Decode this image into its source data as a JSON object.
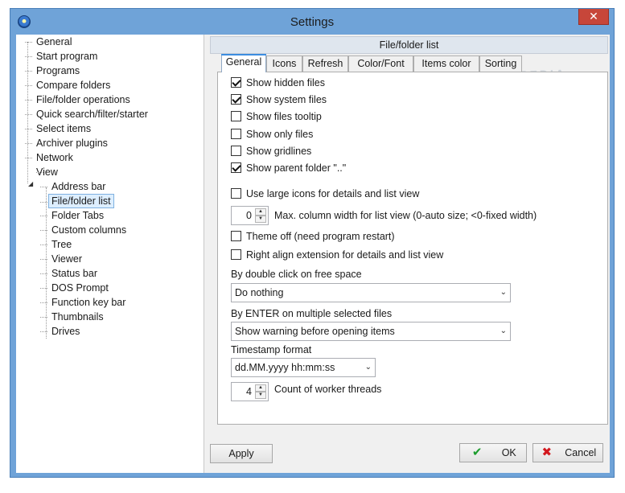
{
  "window": {
    "title": "Settings",
    "close_glyph": "✕"
  },
  "tree": {
    "items": [
      {
        "label": "General"
      },
      {
        "label": "Start program"
      },
      {
        "label": "Programs"
      },
      {
        "label": "Compare folders"
      },
      {
        "label": "File/folder operations"
      },
      {
        "label": "Quick search/filter/starter"
      },
      {
        "label": "Select items"
      },
      {
        "label": "Archiver plugins"
      },
      {
        "label": "Network"
      },
      {
        "label": "View",
        "expanded": true
      },
      {
        "label": "Address bar"
      },
      {
        "label": "File/folder list",
        "selected": true
      },
      {
        "label": "Folder Tabs"
      },
      {
        "label": "Custom columns"
      },
      {
        "label": "Tree"
      },
      {
        "label": "Viewer"
      },
      {
        "label": "Status bar"
      },
      {
        "label": "DOS Prompt"
      },
      {
        "label": "Function key bar"
      },
      {
        "label": "Thumbnails"
      },
      {
        "label": "Drives"
      }
    ]
  },
  "section_header": "File/folder list",
  "tabs": [
    {
      "label": "General",
      "active": true
    },
    {
      "label": "Icons"
    },
    {
      "label": "Refresh"
    },
    {
      "label": "Color/Font"
    },
    {
      "label": "Items color"
    },
    {
      "label": "Sorting"
    }
  ],
  "options": [
    {
      "label": "Show hidden files",
      "checked": true
    },
    {
      "label": "Show system files",
      "checked": true
    },
    {
      "label": "Show files tooltip",
      "checked": false
    },
    {
      "label": "Show only files",
      "checked": false
    },
    {
      "label": "Show gridlines",
      "checked": false
    },
    {
      "label": "Show parent folder \"..\"",
      "checked": true
    },
    {
      "label": "Use large icons for details and list view",
      "checked": false
    },
    {
      "label": "Theme off (need program restart)",
      "checked": false
    },
    {
      "label": "Right align extension for details and list view",
      "checked": false
    }
  ],
  "max_column_width": {
    "value": "0",
    "label": "Max. column width for list view (0-auto size; <0-fixed width)"
  },
  "double_click": {
    "label": "By double click on free space",
    "value": "Do nothing"
  },
  "enter_multi": {
    "label": "By ENTER on multiple selected files",
    "value": "Show warning before opening items"
  },
  "timestamp": {
    "label": "Timestamp format",
    "value": "dd.MM.yyyy hh:mm:ss"
  },
  "worker_threads": {
    "value": "4",
    "label": "Count of worker threads"
  },
  "buttons": {
    "apply": "Apply",
    "ok": "OK",
    "cancel": "Cancel"
  },
  "icons": {
    "ok_glyph": "✔",
    "cancel_glyph": "✖",
    "spin_up": "▲",
    "spin_down": "▼",
    "combo_arrow": "⌄",
    "expander": "◢"
  },
  "watermark": "SOFTPEDIA",
  "colors": {
    "frame": "#6fa3d8",
    "close": "#c7463a",
    "tab_accent": "#3c8de0",
    "selected_bg": "#ddeeff"
  }
}
